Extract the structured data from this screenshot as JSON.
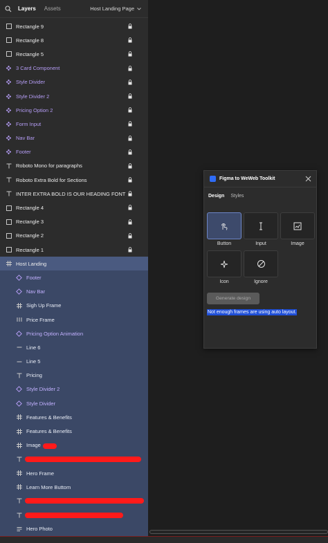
{
  "header": {
    "tabs": [
      {
        "label": "Layers"
      },
      {
        "label": "Assets"
      }
    ],
    "page_name": "Host Landing Page"
  },
  "layers": [
    {
      "label": "Rectangle 9",
      "icon": "rectangle-icon",
      "style": "white",
      "locked": true
    },
    {
      "label": "Rectangle 8",
      "icon": "rectangle-icon",
      "style": "white",
      "locked": true
    },
    {
      "label": "Rectangle 5",
      "icon": "rectangle-icon",
      "style": "white",
      "locked": true
    },
    {
      "label": "3 Card Component",
      "icon": "component-icon",
      "style": "purple",
      "locked": true
    },
    {
      "label": "Style Divider",
      "icon": "component-icon",
      "style": "purple",
      "locked": true
    },
    {
      "label": "Style Divider 2",
      "icon": "component-icon",
      "style": "purple",
      "locked": true
    },
    {
      "label": "Pricing Option 2",
      "icon": "component-icon",
      "style": "purple",
      "locked": true
    },
    {
      "label": "Form Input",
      "icon": "component-icon",
      "style": "purple",
      "locked": true
    },
    {
      "label": "Nav Bar",
      "icon": "component-icon",
      "style": "purple",
      "locked": true
    },
    {
      "label": "Footer",
      "icon": "component-icon",
      "style": "purple",
      "locked": true
    },
    {
      "label": "Roboto Mono for paragraphs",
      "icon": "text-icon",
      "style": "white",
      "locked": true
    },
    {
      "label": "Roboto Extra Bold for Sections",
      "icon": "text-icon",
      "style": "white",
      "locked": true
    },
    {
      "label": "INTER EXTRA BOLD IS OUR HEADING FONT",
      "icon": "text-icon",
      "style": "white",
      "locked": true
    },
    {
      "label": "Rectangle 4",
      "icon": "rectangle-icon",
      "style": "white",
      "locked": true
    },
    {
      "label": "Rectangle 3",
      "icon": "rectangle-icon",
      "style": "white",
      "locked": true
    },
    {
      "label": "Rectangle 2",
      "icon": "rectangle-icon",
      "style": "white",
      "locked": true
    },
    {
      "label": "Rectangle 1",
      "icon": "rectangle-icon",
      "style": "white",
      "locked": true
    }
  ],
  "selected_frame": {
    "label": "Host Landing",
    "icon": "frame-icon"
  },
  "children": [
    {
      "label": "Footer",
      "icon": "instance-icon",
      "style": "purple"
    },
    {
      "label": "Nav Bar",
      "icon": "instance-icon",
      "style": "purple"
    },
    {
      "label": "Sigh Up Frame",
      "icon": "frame-icon",
      "style": "white"
    },
    {
      "label": "Price Frame",
      "icon": "autolayout-icon",
      "style": "white"
    },
    {
      "label": "Pricing Option Animation",
      "icon": "instance-icon",
      "style": "purple"
    },
    {
      "label": "Line 6",
      "icon": "line-icon",
      "style": "white"
    },
    {
      "label": "Line 5",
      "icon": "line-icon",
      "style": "white"
    },
    {
      "label": "Pricing",
      "icon": "text-icon",
      "style": "white"
    },
    {
      "label": "Style Divider 2",
      "icon": "instance-icon",
      "style": "purple"
    },
    {
      "label": "Style Divider",
      "icon": "instance-icon",
      "style": "purple"
    },
    {
      "label": "Features & Benefits",
      "icon": "frame-icon",
      "style": "white"
    },
    {
      "label": "Features & Benefits",
      "icon": "frame-icon",
      "style": "white"
    },
    {
      "label": "Image",
      "icon": "frame-icon",
      "style": "white"
    },
    {
      "label": "",
      "icon": "text-icon",
      "style": "white"
    },
    {
      "label": "Hero Frame",
      "icon": "frame-icon",
      "style": "white"
    },
    {
      "label": "Learn More Buttom",
      "icon": "frame-icon",
      "style": "white"
    },
    {
      "label": "",
      "icon": "text-icon",
      "style": "white"
    },
    {
      "label": "",
      "icon": "text-icon",
      "style": "white"
    },
    {
      "label": "Hero Photo",
      "icon": "list-icon",
      "style": "white"
    }
  ],
  "plugin": {
    "title": "Figma to WeWeb Toolkit",
    "tabs": [
      {
        "label": "Design"
      },
      {
        "label": "Styles"
      }
    ],
    "tiles": [
      {
        "label": "Button",
        "icon": "touch-icon"
      },
      {
        "label": "Input",
        "icon": "text-cursor-icon"
      },
      {
        "label": "Image",
        "icon": "image-icon"
      },
      {
        "label": "Icon",
        "icon": "sparkle-icon"
      },
      {
        "label": "Ignore",
        "icon": "ban-icon"
      }
    ],
    "generate_button": "Generate design",
    "warning": "Not enough frames are using auto layout."
  },
  "colors": {
    "panel_bg": "#2c2c2c",
    "canvas_bg": "#1e1e1e",
    "component_purple": "#b49cf4",
    "selection_blue": "#4a5a80",
    "highlight_blue": "#1f4fd8",
    "redaction_red": "#ff1a1a"
  }
}
